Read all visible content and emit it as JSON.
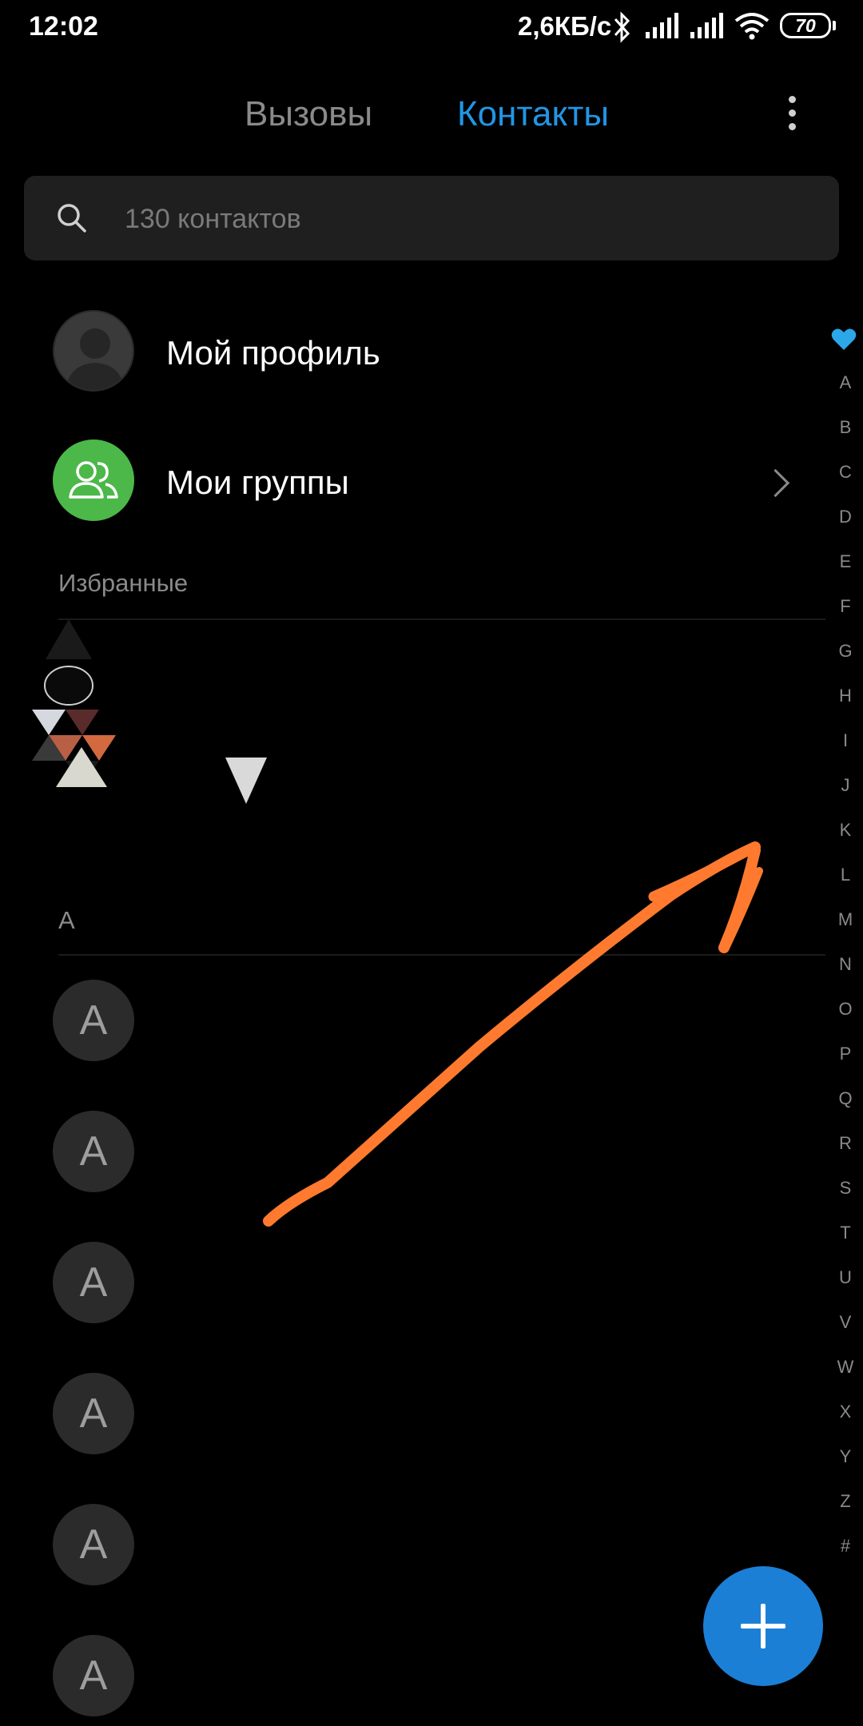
{
  "status_bar": {
    "time": "12:02",
    "network_speed": "2,6КБ/с",
    "battery_level": "70",
    "icons": [
      "bluetooth-icon",
      "signal-icon",
      "signal-icon",
      "wifi-icon",
      "battery-icon"
    ]
  },
  "tabs": {
    "calls_label": "Вызовы",
    "contacts_label": "Контакты",
    "active": "contacts",
    "active_color": "#2196e6",
    "inactive_color": "#8a8a8a"
  },
  "search": {
    "placeholder": "130 контактов",
    "value": ""
  },
  "my_profile": {
    "label": "Мой профиль"
  },
  "my_groups": {
    "label": "Мои группы",
    "avatar_color": "#4cb849"
  },
  "sections": {
    "favorites_label": "Избранные",
    "a_label": "A"
  },
  "contacts_a": [
    {
      "initial": "A"
    },
    {
      "initial": "A"
    },
    {
      "initial": "A"
    },
    {
      "initial": "A"
    },
    {
      "initial": "A"
    },
    {
      "initial": "A"
    }
  ],
  "alphabet_index": [
    "A",
    "B",
    "C",
    "D",
    "E",
    "F",
    "G",
    "H",
    "I",
    "J",
    "K",
    "L",
    "M",
    "N",
    "O",
    "P",
    "Q",
    "R",
    "S",
    "T",
    "U",
    "V",
    "W",
    "X",
    "Y",
    "Z",
    "#"
  ],
  "fab": {
    "icon": "plus-icon",
    "color": "#1c7fd6"
  },
  "annotation": {
    "arrow_color": "#ff7a2f"
  }
}
